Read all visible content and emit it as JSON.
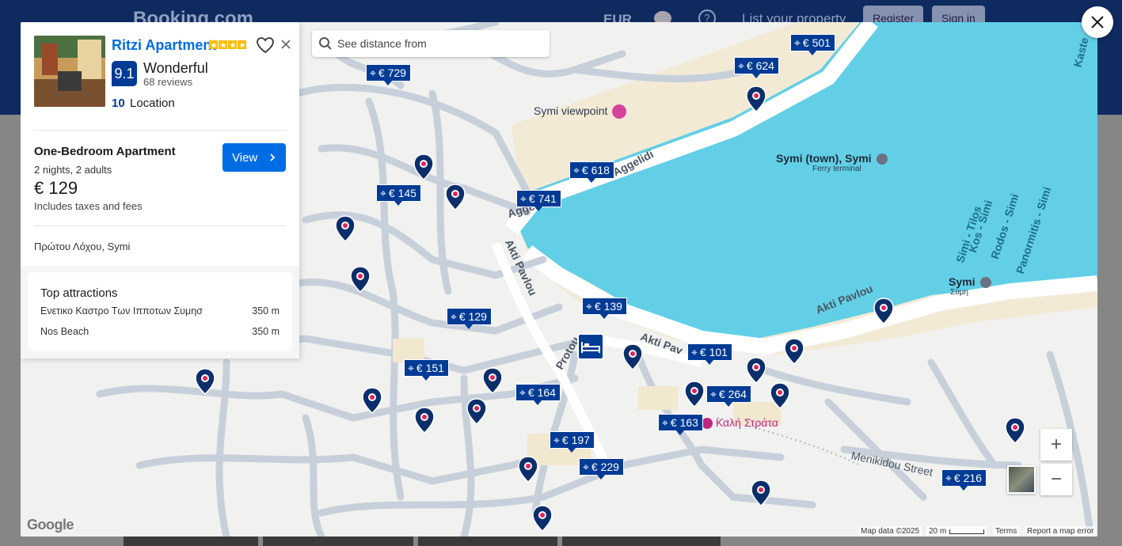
{
  "background": {
    "logo": "Booking.com",
    "currency": "EUR",
    "list_property": "List your property",
    "register": "Register",
    "sign_in": "Sign in"
  },
  "map": {
    "search_placeholder": "See distance from",
    "labels": {
      "viewpoint": "Symi viewpoint",
      "town": "Symi (town), Symi",
      "ferry": "Ferry terminal",
      "symi": "Symi",
      "symi_greek": "Σύμη",
      "kali_strata": "Καλή Στράτα"
    },
    "roads": {
      "aggelidi_1": "Aggelidi",
      "aggelidi_2": "Aggelidi",
      "akti_pavlou_1": "Akti Pavlou",
      "akti_pavlou_2": "Akti Pavlou",
      "akti_pavlou_3": "Akti Pav",
      "protou": "Protou",
      "menikidou": "Menikidou Street",
      "kaste": "Kaste"
    },
    "sea_labels": {
      "tilos": "Simi - Tilos",
      "kos": "Kos - Simi",
      "rodos": "Rodos - Simi",
      "panormitis": "Panormitis - Simi"
    },
    "prices": [
      "€ 501",
      "€ 729",
      "€ 624",
      "€ 618",
      "€ 145",
      "€ 741",
      "€ 139",
      "€ 129",
      "€ 101",
      "€ 151",
      "€ 164",
      "€ 264",
      "€ 163",
      "€ 197",
      "€ 229",
      "€ 216"
    ],
    "footer": {
      "google": "Google",
      "map_data": "Map data ©2025",
      "scale": "20 m",
      "terms": "Terms",
      "report": "Report a map error"
    },
    "zoom_in": "+",
    "zoom_out": "−"
  },
  "property": {
    "name": "Ritzi Apartment",
    "stars": 4,
    "score": "9.1",
    "score_word": "Wonderful",
    "reviews": "68 reviews",
    "location_score": "10",
    "location_label": "Location",
    "room_type": "One-Bedroom Apartment",
    "stay": "2 nights, 2 adults",
    "price": "€ 129",
    "taxes": "Includes taxes and fees",
    "view_label": "View",
    "address": "Πρώτου Λόχου, Symi",
    "attractions_title": "Top attractions",
    "attractions": [
      {
        "name": "Ενετικο Καστρο Των Ιπποτων Συμησ",
        "distance": "350 m"
      },
      {
        "name": "Nos Beach",
        "distance": "350 m"
      }
    ]
  },
  "colors": {
    "brand": "#003b95",
    "link": "#006ce4",
    "sea": "#62cfe6",
    "star": "#febb02"
  }
}
